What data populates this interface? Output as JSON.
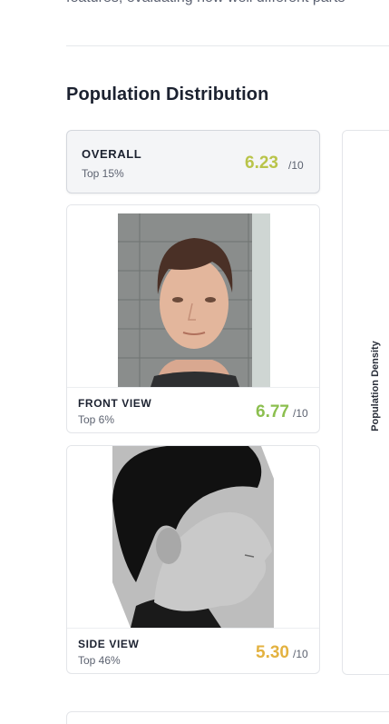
{
  "intro": {
    "text": "features, evaluating how well different parts"
  },
  "section": {
    "title": "Population Distribution"
  },
  "overall": {
    "label": "OVERALL",
    "rank": "Top 15%",
    "score": "6.23",
    "unit": "/10"
  },
  "views": [
    {
      "label": "FRONT VIEW",
      "rank": "Top 6%",
      "score": "6.77",
      "unit": "/10"
    },
    {
      "label": "SIDE VIEW",
      "rank": "Top 46%",
      "score": "5.30",
      "unit": "/10"
    }
  ],
  "density": {
    "axis_label": "Population Density"
  },
  "colors": {
    "overall_score": "#b9c44a",
    "front_score": "#8cbf4f",
    "side_score": "#e3b240"
  }
}
